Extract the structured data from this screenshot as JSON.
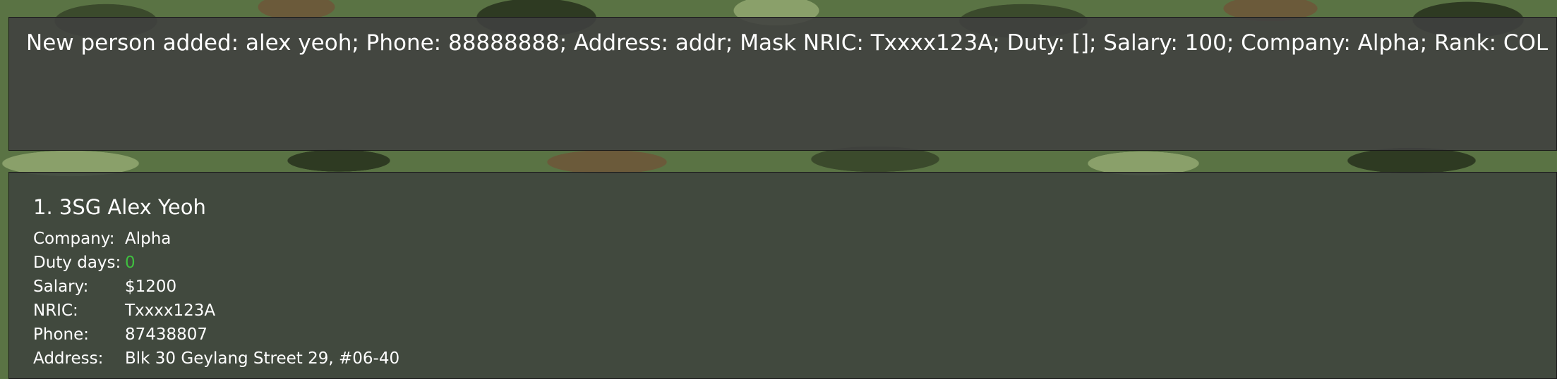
{
  "result_display": {
    "message": "New person added: alex yeoh; Phone: 88888888; Address: addr; Mask NRIC: Txxxx123A; Duty: []; Salary: 100; Company: Alpha; Rank: COL"
  },
  "person_list": [
    {
      "title": "1. 3SG Alex Yeoh",
      "fields": [
        {
          "label": "Company:",
          "value": "Alpha"
        },
        {
          "label": "Duty days:",
          "value": "0"
        },
        {
          "label": "Salary:",
          "value": "$1200"
        },
        {
          "label": "NRIC:",
          "value": "Txxxx123A"
        },
        {
          "label": "Phone:",
          "value": "87438807"
        },
        {
          "label": "Address:",
          "value": "Blk 30 Geylang Street 29, #06-40"
        }
      ]
    }
  ],
  "colors": {
    "panel_background": "#404040",
    "duty_value": "#3fbf3f",
    "text": "#ffffff"
  }
}
